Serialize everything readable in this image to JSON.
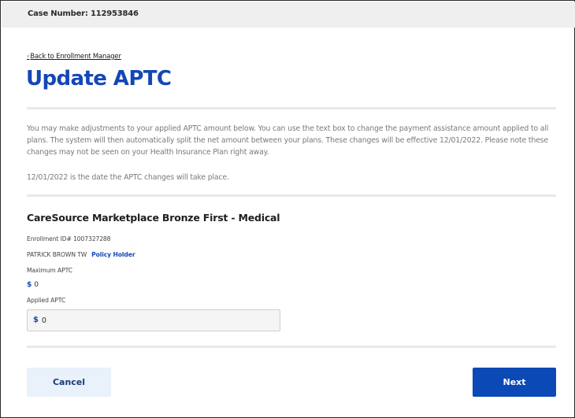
{
  "case_number": "Case Number: 112953846",
  "back_link": {
    "chevron": "‹",
    "label": "Back to Enrollment Manager"
  },
  "page_title": "Update APTC",
  "intro_text": "You may make adjustments to your applied APTC amount below. You can use the text box to change the payment assistance amount applied to all plans. The system will then automatically split the net amount between your plans. These changes will be effective 12/01/2022. Please note these changes may not be seen on your Health Insurance Plan right away.",
  "effective_note": "12/01/2022 is the date the APTC changes will take place.",
  "plan": {
    "name": "CareSource Marketplace Bronze First - Medical",
    "enrollment_id": "Enrollment ID# 1007327288",
    "member_name": "PATRICK BROWN TW",
    "member_role": "Policy Holder",
    "max_aptc_label": "Maximum APTC",
    "max_aptc_currency": "$",
    "max_aptc_value": "0",
    "applied_aptc_label": "Applied APTC",
    "applied_aptc_currency": "$",
    "applied_aptc_value": "0"
  },
  "buttons": {
    "cancel": "Cancel",
    "next": "Next"
  },
  "colors": {
    "title_blue": "#1347b7",
    "primary_button": "#0b49b6",
    "secondary_button": "#e9f1fb",
    "header_bar": "#efefef"
  }
}
